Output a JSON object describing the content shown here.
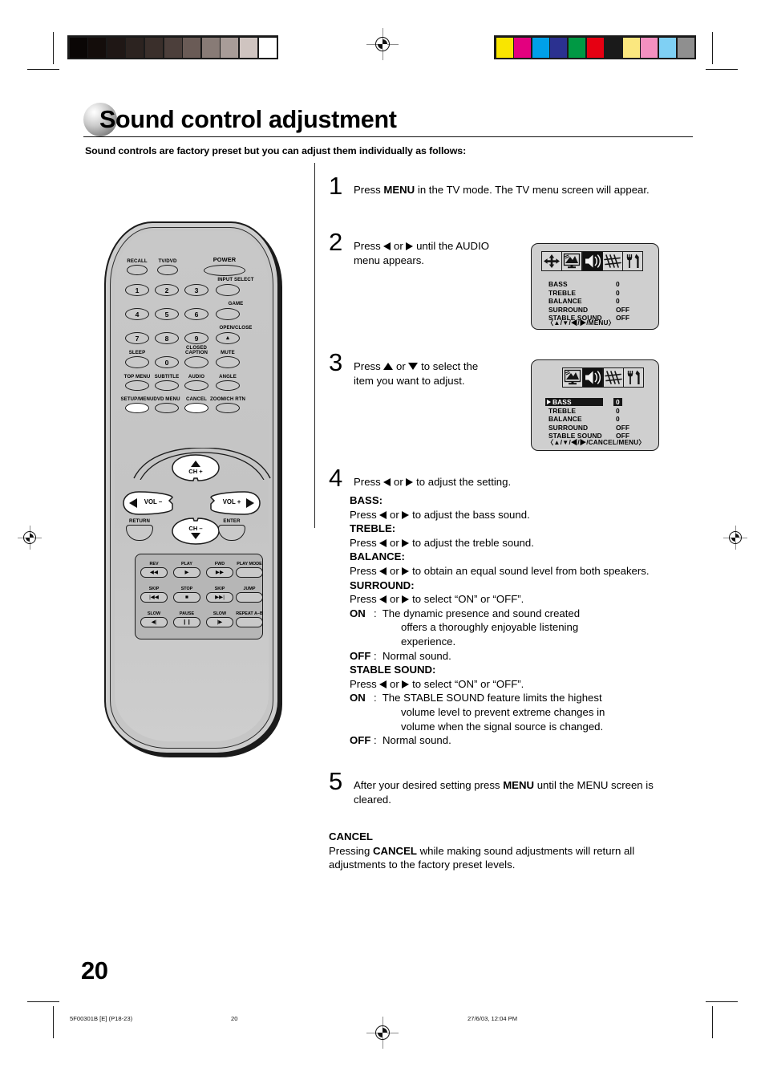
{
  "header": {
    "title": "Sound control adjustment",
    "subtitle": "Sound controls are factory preset but you can adjust them individually as follows:"
  },
  "steps": [
    {
      "num": "1",
      "text_html": "Press <b>MENU</b> in the TV mode. The TV menu screen will appear.",
      "text": "Press MENU in the TV mode. The TV menu screen will appear."
    },
    {
      "num": "2",
      "text_html": "Press <span class=\"arrowl\"></span> or <span class=\"arrowr\"></span> until the AUDIO menu appears.",
      "text": "Press ◀ or ▶ until the AUDIO menu appears."
    },
    {
      "num": "3",
      "text_html": "Press <span class=\"arrowu\"></span> or <span class=\"arrowd\"></span> to select the item you want to adjust.",
      "text": "Press ▲ or ▼ to select the item you want to adjust."
    },
    {
      "num": "4",
      "text_html": "Press <span class=\"arrowl\"></span> or <span class=\"arrowr\"></span> to adjust the setting.",
      "text": "Press ◀ or ▶ to adjust the setting."
    },
    {
      "num": "5",
      "text_html": "After your desired setting press <b>MENU</b> until the MENU screen is cleared.",
      "text": "After your desired setting press MENU until the MENU screen is cleared."
    }
  ],
  "step4_details_html": "<div class=\"hd\">BASS:</div><div>Press <span class=\"arrowl\"></span> or <span class=\"arrowr\"></span> to adjust the bass sound.</div><div class=\"hd\">TREBLE:</div><div>Press <span class=\"arrowl\"></span> or <span class=\"arrowr\"></span> to adjust the treble sound.</div><div class=\"hd\">BALANCE:</div><div>Press <span class=\"arrowl\"></span> or <span class=\"arrowr\"></span> to obtain an equal sound level from both speakers.</div><div class=\"hd\">SURROUND:</div><div>Press <span class=\"arrowl\"></span> or <span class=\"arrowr\"></span> to select &ldquo;ON&rdquo; or &ldquo;OFF&rdquo;.</div><div class=\"indent\"><span class=\"k\">ON</span>:&nbsp; The dynamic presence and sound created</div><div class=\"indent2\">offers a thoroughly enjoyable listening</div><div class=\"indent2\">experience.</div><div class=\"indent\"><span class=\"k\">OFF</span>:&nbsp; Normal sound.</div><div class=\"hd\">STABLE SOUND:</div><div>Press <span class=\"arrowl\"></span> or <span class=\"arrowr\"></span> to select &ldquo;ON&rdquo; or &ldquo;OFF&rdquo;.</div><div class=\"indent\"><span class=\"k\">ON</span>:&nbsp; The STABLE SOUND feature limits the highest</div><div class=\"indent2\">volume level to prevent extreme changes in</div><div class=\"indent2\">volume when the signal source is changed.</div><div class=\"indent\"><span class=\"k\">OFF</span>:&nbsp; Normal sound.</div>",
  "step4_details_text": "BASS: Press ◀ or ▶ to adjust the bass sound. TREBLE: Press ◀ or ▶ to adjust the treble sound. BALANCE: Press ◀ or ▶ to obtain an equal sound level from both speakers. SURROUND: Press ◀ or ▶ to select “ON” or “OFF”. ON: The dynamic presence and sound created offers a thoroughly enjoyable listening experience. OFF: Normal sound. STABLE SOUND: Press ◀ or ▶ to select “ON” or “OFF”. ON: The STABLE SOUND feature limits the highest volume level to prevent extreme changes in volume when the signal source is changed. OFF: Normal sound.",
  "cancel_note": {
    "heading": "CANCEL",
    "text_html": "Pressing <b>CANCEL</b> while making sound adjustments will return all adjustments to the factory preset levels.",
    "text": "Pressing CANCEL while making sound adjustments will return all adjustments to the factory preset levels."
  },
  "tv_menu_1": {
    "icons": [
      "nav-arrows-icon",
      "picture-icon",
      "speaker-icon",
      "antenna-icon",
      "tools-icon"
    ],
    "selected_icon_index": 2,
    "rows": [
      {
        "label": "BASS",
        "value": "0",
        "highlighted": false
      },
      {
        "label": "TREBLE",
        "value": "0",
        "highlighted": false
      },
      {
        "label": "BALANCE",
        "value": "0",
        "highlighted": false
      },
      {
        "label": "SURROUND",
        "value": "OFF",
        "highlighted": false
      },
      {
        "label": "STABLE SOUND",
        "value": "OFF",
        "highlighted": false
      }
    ],
    "hint": "〈▲/▼/◀/▶/MENU〉"
  },
  "tv_menu_2": {
    "icons": [
      "picture-icon",
      "speaker-icon",
      "antenna-icon",
      "tools-icon"
    ],
    "selected_icon_index": 1,
    "rows": [
      {
        "label": "BASS",
        "value": "0",
        "highlighted": true
      },
      {
        "label": "TREBLE",
        "value": "0",
        "highlighted": false
      },
      {
        "label": "BALANCE",
        "value": "0",
        "highlighted": false
      },
      {
        "label": "SURROUND",
        "value": "OFF",
        "highlighted": false
      },
      {
        "label": "STABLE SOUND",
        "value": "OFF",
        "highlighted": false
      }
    ],
    "hint": "〈▲/▼/◀/▶/CANCEL/MENU〉"
  },
  "remote": {
    "top_row": [
      "RECALL",
      "TV/DVD",
      "POWER"
    ],
    "side_labels": [
      "INPUT SELECT",
      "GAME",
      "OPEN/CLOSE",
      "MUTE"
    ],
    "keypad": [
      "1",
      "2",
      "3",
      "4",
      "5",
      "6",
      "7",
      "8",
      "9",
      "0"
    ],
    "labels_row_sleep": [
      "SLEEP",
      "CLOSED CAPTION"
    ],
    "labels_row_menu": [
      "TOP MENU",
      "SUBTITLE",
      "AUDIO",
      "ANGLE"
    ],
    "labels_row_setup": [
      "SETUP/MENU",
      "DVD MENU",
      "CANCEL",
      "ZOOM/CH RTN"
    ],
    "nav": {
      "ch_up": "CH +",
      "ch_down": "CH –",
      "vol_down": "VOL –",
      "vol_up": "VOL +",
      "return": "RETURN",
      "enter": "ENTER"
    },
    "transport": [
      {
        "label": "REV",
        "icon": "rewind-icon",
        "glyph": "◀◀"
      },
      {
        "label": "PLAY",
        "icon": "play-icon",
        "glyph": "▶"
      },
      {
        "label": "FWD",
        "icon": "fast-forward-icon",
        "glyph": "▶▶"
      },
      {
        "label": "PLAY MODE",
        "icon": "",
        "glyph": ""
      },
      {
        "label": "SKIP",
        "icon": "skip-back-icon",
        "glyph": "|◀◀"
      },
      {
        "label": "STOP",
        "icon": "stop-icon",
        "glyph": "■"
      },
      {
        "label": "SKIP",
        "icon": "skip-forward-icon",
        "glyph": "▶▶|"
      },
      {
        "label": "JUMP",
        "icon": "",
        "glyph": ""
      },
      {
        "label": "SLOW",
        "icon": "slow-back-icon",
        "glyph": "◀|"
      },
      {
        "label": "PAUSE",
        "icon": "pause-icon",
        "glyph": "❙❙"
      },
      {
        "label": "SLOW",
        "icon": "slow-forward-icon",
        "glyph": "|▶"
      },
      {
        "label": "REPEAT A–B",
        "icon": "",
        "glyph": ""
      }
    ]
  },
  "page_number": "20",
  "footer": {
    "doc_id": "5F00301B [E] (P18-23)",
    "page": "20",
    "timestamp": "27/6/03, 12:04 PM"
  },
  "print_marks": {
    "grayscale_bar": [
      "#0a0605",
      "#140d0b",
      "#1f1715",
      "#2c2320",
      "#3a2f2b",
      "#4c3f3b",
      "#6a5b56",
      "#887b76",
      "#a89c98",
      "#cfc4c0",
      "#ffffff"
    ],
    "color_bar": [
      "#f9e500",
      "#e3007f",
      "#00a0e9",
      "#2b3190",
      "#009944",
      "#e60012",
      "#1a1a1a",
      "#fbe77f",
      "#f490c0",
      "#7fd0f4",
      "#8f8f8f"
    ]
  }
}
